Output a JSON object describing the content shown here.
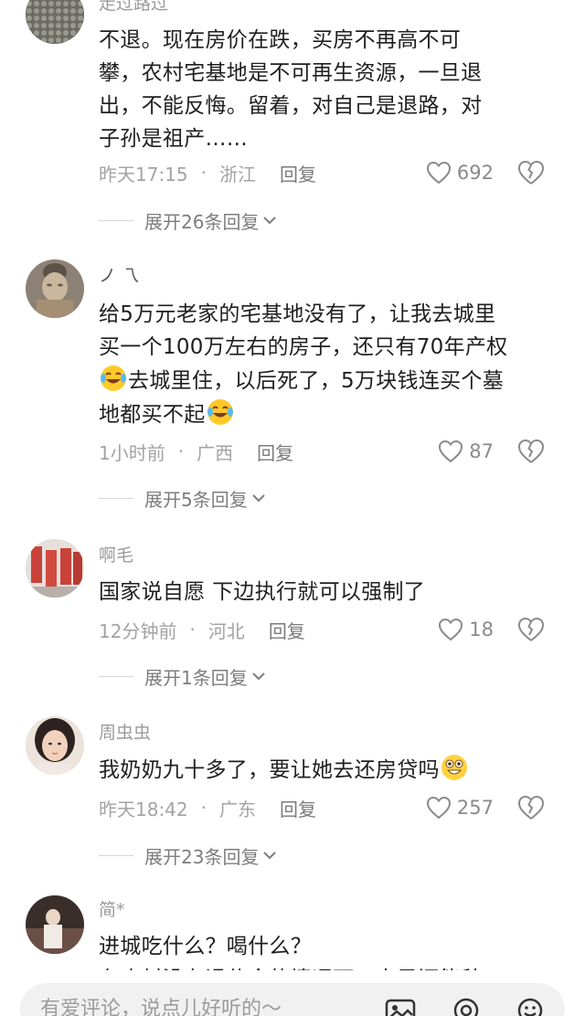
{
  "comments": [
    {
      "username": "走过路过",
      "lines": [
        "不退。现在房价在跌，买房不再高不可",
        "攀，农村宅基地是不可再生资源，一旦退",
        "出，不能反悔。留着，对自己是退路，对",
        "子孙是祖产……"
      ],
      "time": "昨天17:15",
      "location": "浙江",
      "reply_label": "回复",
      "likes": "692",
      "expand_label": "展开26条回复"
    },
    {
      "username": "ノ 乁",
      "line1": "给5万元老家的宅基地没有了，让我去城里",
      "line2": "买一个100万左右的房子，还只有70年产权",
      "line3": "去城里住，以后死了，5万块钱连买个墓",
      "line4": "地都买不起",
      "time": "1小时前",
      "location": "广西",
      "reply_label": "回复",
      "likes": "87",
      "expand_label": "展开5条回复"
    },
    {
      "username": "啊毛",
      "line1": "国家说自愿 下边执行就可以强制了",
      "time": "12分钟前",
      "location": "河北",
      "reply_label": "回复",
      "likes": "18",
      "expand_label": "展开1条回复"
    },
    {
      "username": "周虫虫",
      "line1": "我奶奶九十多了，要让她去还房贷吗",
      "time": "昨天18:42",
      "location": "广东",
      "reply_label": "回复",
      "likes": "257",
      "expand_label": "展开23条回复"
    },
    {
      "username": "简*",
      "line1": "进城吃什么？喝什么？",
      "line2": "在农村没有退休金的情况下，自己还能种"
    }
  ],
  "input": {
    "placeholder": "有爱评论，说点儿好听的～"
  },
  "colors": {
    "meta": "#a3a3a3",
    "text": "#1f1f1f",
    "input_bg": "#f1f1f1"
  }
}
